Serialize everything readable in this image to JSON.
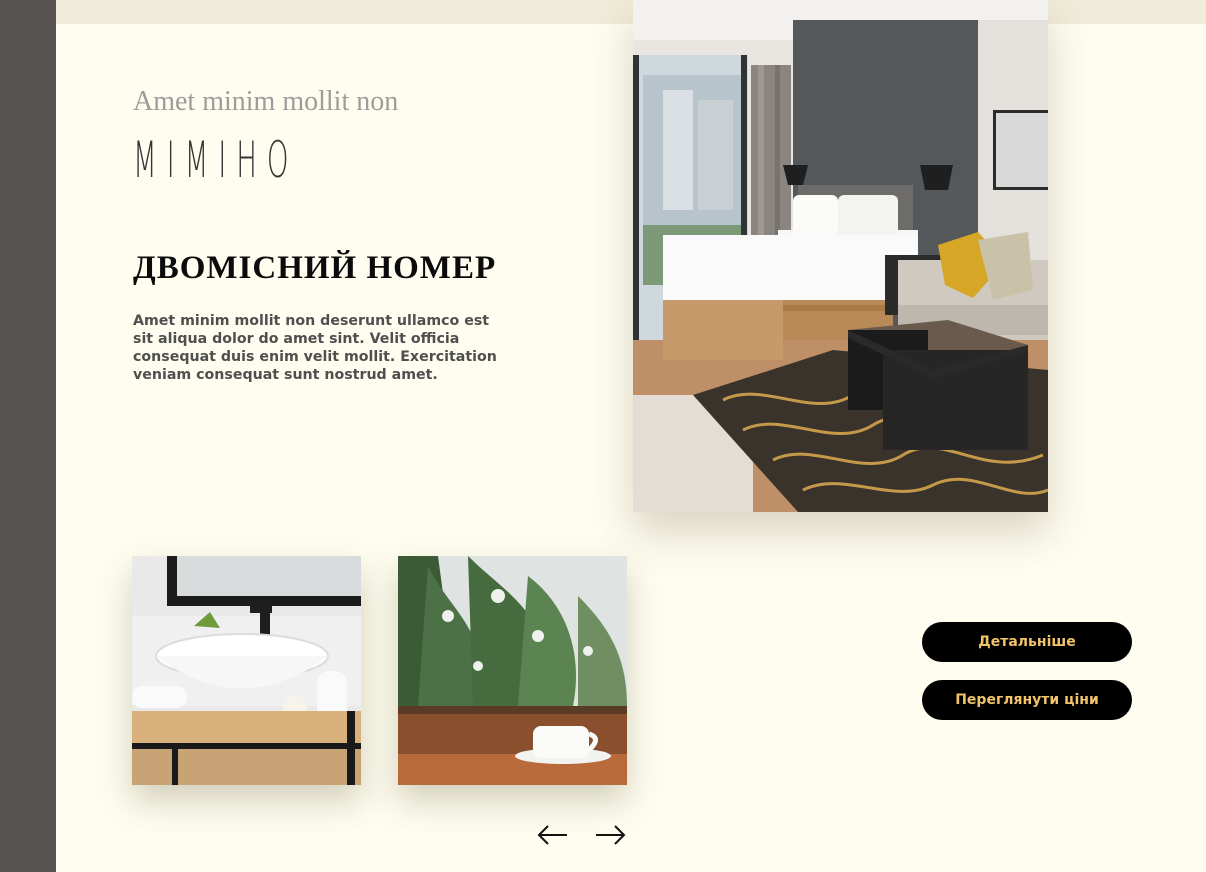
{
  "header": {
    "tagline": "Amet minim mollit non",
    "brand": "MIMIHO"
  },
  "room": {
    "title": "ДВОМІСНИЙ НОМЕР",
    "description": "Amet minim mollit non deserunt ullamco est sit aliqua dolor do amet sint. Velit officia consequat duis enim velit mollit. Exercitation veniam consequat sunt nostrud amet."
  },
  "actions": {
    "details_label": "Детальніше",
    "prices_label": "Переглянути ціни"
  },
  "carousel": {
    "prev_icon": "arrow-left-icon",
    "next_icon": "arrow-right-icon"
  },
  "images": {
    "hero": "hotel-room-photo",
    "thumb_1": "bathroom-sink-photo",
    "thumb_2": "winter-trees-coffee-photo"
  },
  "colors": {
    "background": "#fffdef",
    "sidebar": "#575352",
    "button_bg": "#000000",
    "button_text": "#f2c46a"
  }
}
